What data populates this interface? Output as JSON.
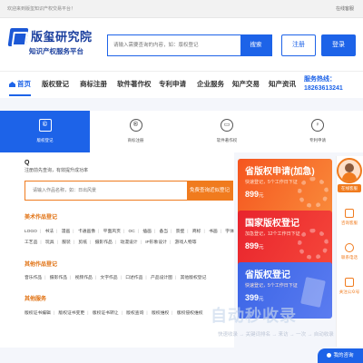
{
  "topbar": {
    "welcome": "欢迎来到版玺知识产权交易平台！",
    "online": "在线客服"
  },
  "header": {
    "logo_title": "版玺研究院",
    "logo_subtitle": "知识产权服务平台",
    "search_placeholder": "请输入需要查询的内容，如：版权登记",
    "search_button": "搜索",
    "register_button": "注册",
    "login_button": "登录"
  },
  "nav": {
    "items": [
      "首页",
      "版权登记",
      "商标注册",
      "软件著作权",
      "专利申请",
      "企业服务",
      "知产交易",
      "知产资讯"
    ],
    "hotline_label": "服务热线：",
    "hotline_number": "18263613241"
  },
  "services": [
    {
      "label": "版权登记",
      "icon": "copyright-icon",
      "glyph": "©"
    },
    {
      "label": "商标注册",
      "icon": "registered-icon",
      "glyph": "®"
    },
    {
      "label": "软件著作权",
      "icon": "software-icon",
      "glyph": "▭"
    },
    {
      "label": "专利申请",
      "icon": "bulb-icon",
      "glyph": "♀"
    }
  ],
  "query": {
    "title": "Q",
    "desc": "注册前先查询，有效提升成功率",
    "placeholder": "请输入作品名称，如：日出风景",
    "button": "免费查询近似登记"
  },
  "categories": [
    {
      "title": "美术作品登记",
      "rows": [
        [
          "LOGO",
          "书法",
          "漫画",
          "卡通画像",
          "平面风页",
          "OC",
          "插画",
          "备当",
          "景壁",
          "商标",
          "书画",
          "字体"
        ],
        [
          "工艺品",
          "玩具",
          "服装",
          "剪纸",
          "摄影作品",
          "动漫设计",
          "IP形象设计",
          "游戏人物等"
        ]
      ]
    },
    {
      "title": "其他作品登记",
      "rows": [
        [
          "音乐作品",
          "摄影作品",
          "视频作品",
          "文字作品",
          "口述作品",
          "产品设计图",
          "其他版权登记"
        ]
      ]
    },
    {
      "title": "其他服务",
      "rows": [
        [
          "版权证书编辑",
          "版权证书变更",
          "版权证书转让",
          "版权查询",
          "版权维权",
          "版权侵权维权"
        ]
      ]
    }
  ],
  "promos": [
    {
      "title": "省版权申请(加急)",
      "subtitle": "快速登记，5个工作日下证",
      "price": "899",
      "unit": "元"
    },
    {
      "title": "国家版权登记",
      "subtitle": "加急登记，12个工作日下证",
      "price": "899",
      "unit": "元"
    },
    {
      "title": "省版权登记",
      "subtitle": "快速登记，5个工作日下证",
      "price": "399",
      "unit": "元"
    }
  ],
  "side": {
    "badge": "在线客服",
    "items": [
      {
        "label": "咨询客服",
        "icon": "chat-icon"
      },
      {
        "label": "联系电话",
        "icon": "phone-icon"
      },
      {
        "label": "关注公众号",
        "icon": "qrcode-icon"
      }
    ]
  },
  "watermark": {
    "text": "自动秒收录",
    "sub": "快速收录 → 关键词排名 → 来访 → 一次 → 自动收录"
  },
  "consult": "我的咨询"
}
